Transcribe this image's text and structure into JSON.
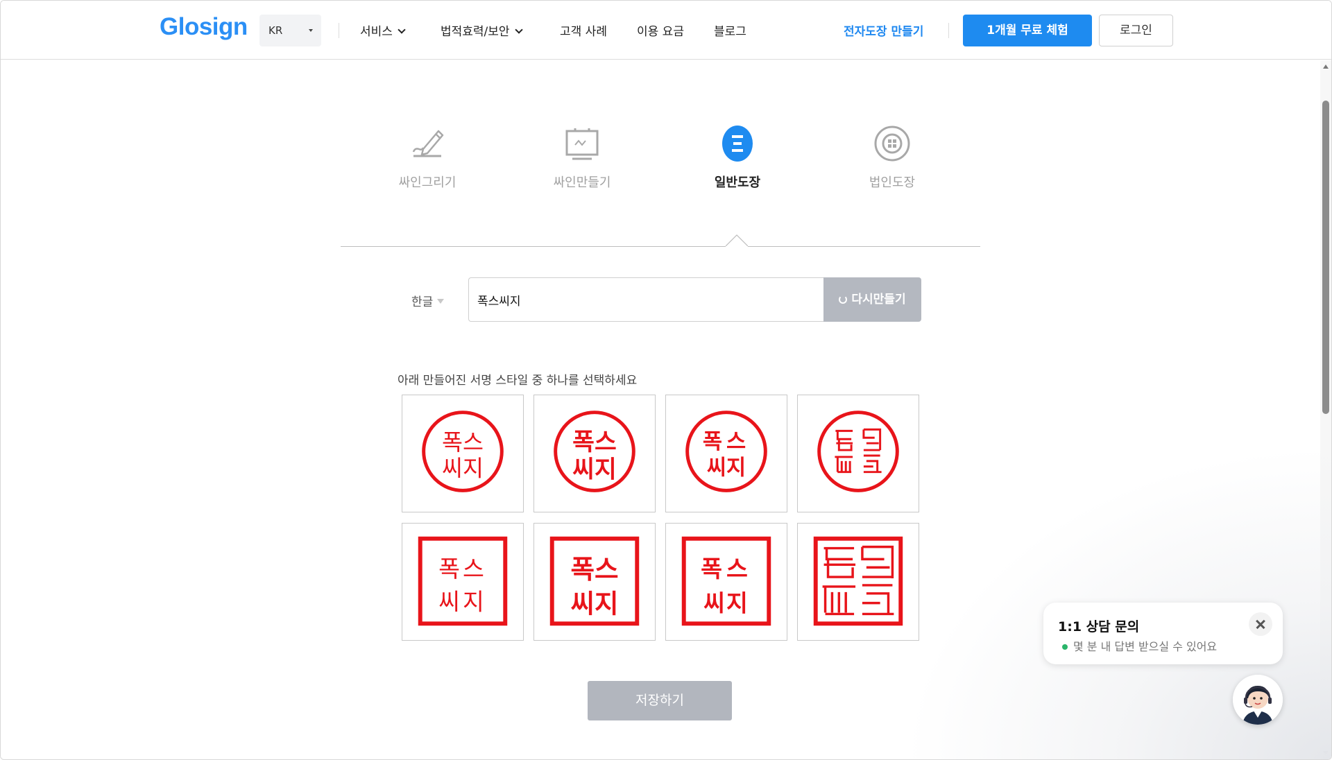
{
  "header": {
    "logo": "Glosign",
    "lang": "KR",
    "nav": [
      "서비스",
      "법적효력/보안",
      "고객 사례",
      "이용 요금",
      "블로그"
    ],
    "cta_link": "전자도장 만들기",
    "trial_button": "1개월 무료 체험",
    "login_button": "로그인"
  },
  "tabs": [
    {
      "label": "싸인그리기",
      "icon": "pen-drawing-icon"
    },
    {
      "label": "싸인만들기",
      "icon": "monitor-signature-icon"
    },
    {
      "label": "일반도장",
      "icon": "stamp-icon",
      "active": true
    },
    {
      "label": "법인도장",
      "icon": "corporate-seal-icon"
    }
  ],
  "form": {
    "lang_select": "한글",
    "name_value": "폭스씨지",
    "regenerate_button": "다시만들기"
  },
  "instruction": "아래 만들어진 서명 스타일 중 하나를 선택하세요",
  "stamps": [
    {
      "shape": "circle",
      "line1": "폭스",
      "line2": "씨지"
    },
    {
      "shape": "circle",
      "line1": "폭스",
      "line2": "씨지"
    },
    {
      "shape": "circle",
      "line1": "폭스",
      "line2": "씨지"
    },
    {
      "shape": "circle",
      "line1": "",
      "line2": "",
      "seal_script": true
    },
    {
      "shape": "square",
      "line1": "폭스",
      "line2": "씨지"
    },
    {
      "shape": "square",
      "line1": "폭스",
      "line2": "씨지"
    },
    {
      "shape": "square",
      "line1": "폭스",
      "line2": "씨지"
    },
    {
      "shape": "square",
      "line1": "",
      "line2": "",
      "seal_script": true
    }
  ],
  "save_button": "저장하기",
  "chat": {
    "title": "1:1 상담 문의",
    "subtitle": "몇 분 내 답변 받으실 수 있어요"
  },
  "colors": {
    "brand": "#2b8ff5",
    "stamp_red": "#e8141a",
    "disabled": "#b2b6be"
  }
}
